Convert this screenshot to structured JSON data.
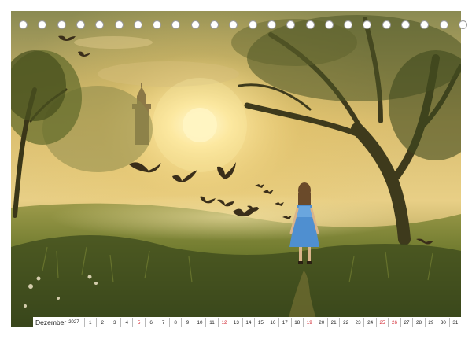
{
  "calendar": {
    "month": "Dezember",
    "year": "2027",
    "days": [
      {
        "n": "1",
        "weekend": false
      },
      {
        "n": "2",
        "weekend": false
      },
      {
        "n": "3",
        "weekend": false
      },
      {
        "n": "4",
        "weekend": false
      },
      {
        "n": "5",
        "weekend": true
      },
      {
        "n": "6",
        "weekend": false
      },
      {
        "n": "7",
        "weekend": false
      },
      {
        "n": "8",
        "weekend": false
      },
      {
        "n": "9",
        "weekend": false
      },
      {
        "n": "10",
        "weekend": false
      },
      {
        "n": "11",
        "weekend": false
      },
      {
        "n": "12",
        "weekend": true
      },
      {
        "n": "13",
        "weekend": false
      },
      {
        "n": "14",
        "weekend": false
      },
      {
        "n": "15",
        "weekend": false
      },
      {
        "n": "16",
        "weekend": false
      },
      {
        "n": "17",
        "weekend": false
      },
      {
        "n": "18",
        "weekend": false
      },
      {
        "n": "19",
        "weekend": true
      },
      {
        "n": "20",
        "weekend": false
      },
      {
        "n": "21",
        "weekend": false
      },
      {
        "n": "22",
        "weekend": false
      },
      {
        "n": "23",
        "weekend": false
      },
      {
        "n": "24",
        "weekend": false
      },
      {
        "n": "25",
        "weekend": true
      },
      {
        "n": "26",
        "weekend": true
      },
      {
        "n": "27",
        "weekend": false
      },
      {
        "n": "28",
        "weekend": false
      },
      {
        "n": "29",
        "weekend": false
      },
      {
        "n": "30",
        "weekend": false
      },
      {
        "n": "31",
        "weekend": false
      }
    ]
  },
  "colors": {
    "weekend": "#d0202a",
    "sun": "#fff6c8",
    "dress": "#4f8fd0"
  }
}
